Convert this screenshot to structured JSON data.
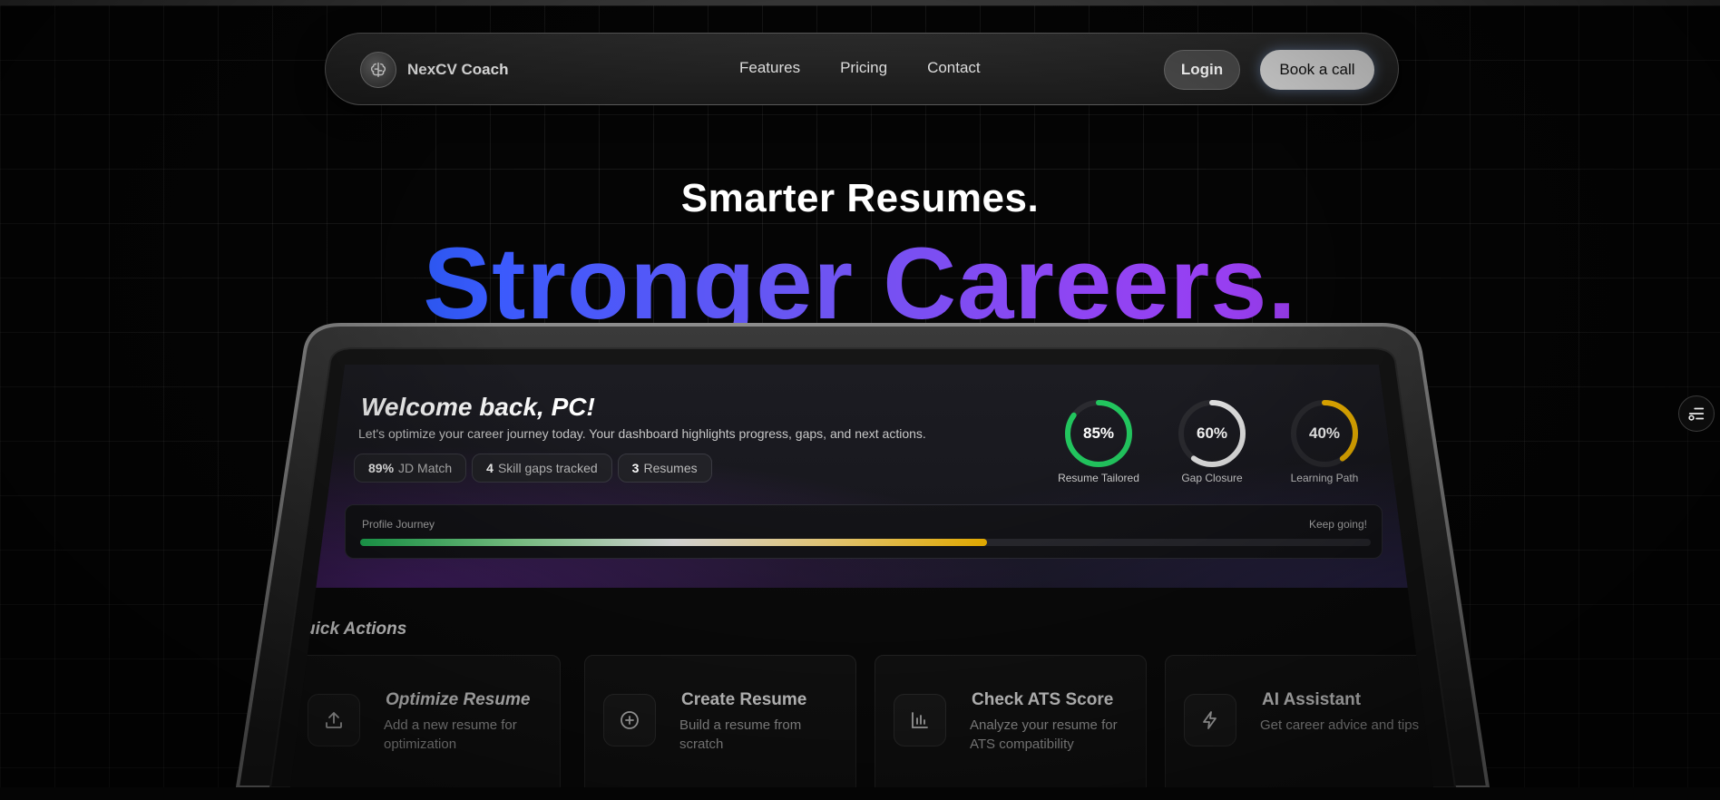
{
  "nav": {
    "brand": "NexCV Coach",
    "links": [
      "Features",
      "Pricing",
      "Contact"
    ],
    "login": "Login",
    "book": "Book a call"
  },
  "hero": {
    "line1": "Smarter Resumes.",
    "line2": "Stronger Careers."
  },
  "dashboard": {
    "welcome": "Welcome back, PC!",
    "subtitle": "Let's optimize your career journey today. Your dashboard highlights progress, gaps, and next actions.",
    "chips": [
      {
        "value": "89%",
        "label": "JD Match"
      },
      {
        "value": "4",
        "label": "Skill gaps tracked"
      },
      {
        "value": "3",
        "label": "Resumes"
      }
    ],
    "rings": [
      {
        "value": "85%",
        "label": "Resume Tailored",
        "fraction": 0.85,
        "color": "#22c55e"
      },
      {
        "value": "60%",
        "label": "Gap Closure",
        "fraction": 0.6,
        "color": "#e6e6e6"
      },
      {
        "value": "40%",
        "label": "Learning Path",
        "fraction": 0.4,
        "color": "#f5b800"
      }
    ],
    "journey": {
      "label": "Profile Journey",
      "status": "Keep going!",
      "progress": 0.62
    },
    "quick_actions_title": "uick Actions",
    "actions": [
      {
        "title": "Optimize Resume",
        "desc": "Add a new resume for optimization",
        "icon": "upload-icon"
      },
      {
        "title": "Create Resume",
        "desc": "Build a resume from scratch",
        "icon": "plus-circle-icon"
      },
      {
        "title": "Check ATS Score",
        "desc": "Analyze your resume for ATS compatibility",
        "icon": "bar-chart-icon"
      },
      {
        "title": "AI Assistant",
        "desc": "Get career advice and tips",
        "icon": "lightning-icon"
      }
    ]
  }
}
